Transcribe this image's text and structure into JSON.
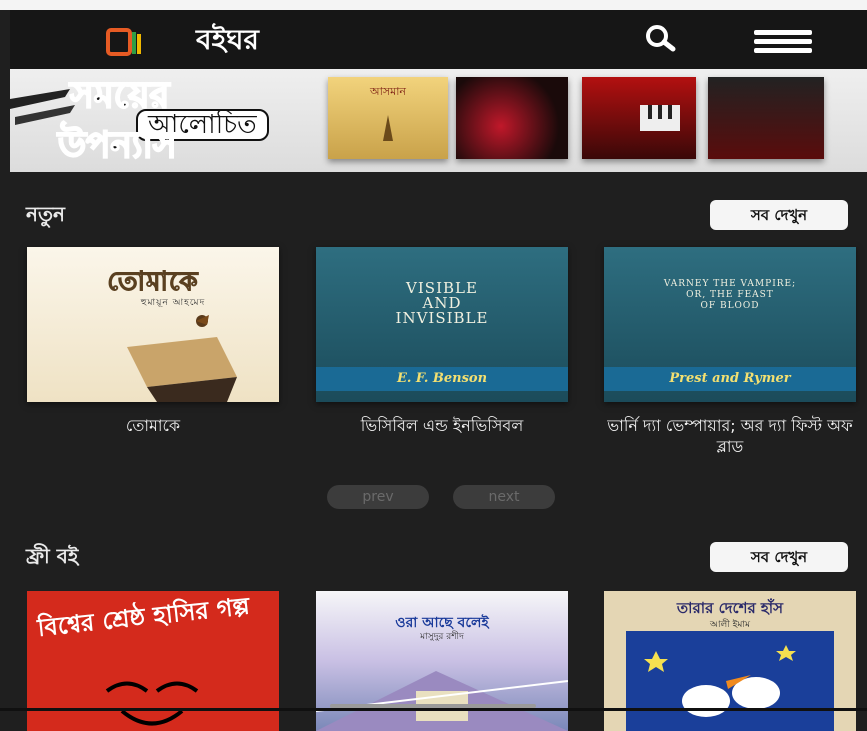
{
  "app": {
    "title": "বইঘর"
  },
  "header": {
    "logo_icon": "books-logo-icon",
    "search_icon": "search-icon",
    "menu_icon": "hamburger-menu-icon"
  },
  "banner": {
    "line1": "সময়ের",
    "line2": "আলোচিত",
    "line3": "উপন্যাস",
    "books": [
      "আসমান",
      "",
      "",
      ""
    ]
  },
  "new_section": {
    "title": "নতুন",
    "see_all": "সব দেখুন",
    "books": [
      {
        "caption": "তোমাকে",
        "cover_title": "তোমাকে",
        "cover_author": "হুমায়ূন আহমেদ"
      },
      {
        "caption": "ভিসিবিল এন্ড ইনভিসিবল",
        "cover_title_lines": [
          "VISIBLE",
          "AND",
          "INVISIBLE"
        ],
        "cover_author": "E. F. Benson"
      },
      {
        "caption": "ভার্নি দ্যা ভেম্পায়ার; অর দ্যা ফিস্ট অফ ব্লাড",
        "cover_title_lines": [
          "VARNEY THE VAMPIRE;",
          "OR, THE FEAST",
          "OF BLOOD"
        ],
        "cover_author": "Prest and Rymer"
      }
    ],
    "prev": "prev",
    "next": "next"
  },
  "free_section": {
    "title": "ফ্রী বই",
    "see_all": "সব দেখুন",
    "books": [
      {
        "cover_title": "বিশ্বের শ্রেষ্ঠ হাসির গল্প"
      },
      {
        "cover_title": "ওরা আছে বলেই",
        "cover_author": "মাসুদুর রশীদ"
      },
      {
        "cover_title": "তারার দেশের হাঁস",
        "cover_author": "আলী ইমাম"
      }
    ]
  },
  "colors": {
    "background": "#1f1f1f",
    "header": "#161616",
    "button": "#f5f5f5",
    "accent_blue": "#1a6a95"
  }
}
